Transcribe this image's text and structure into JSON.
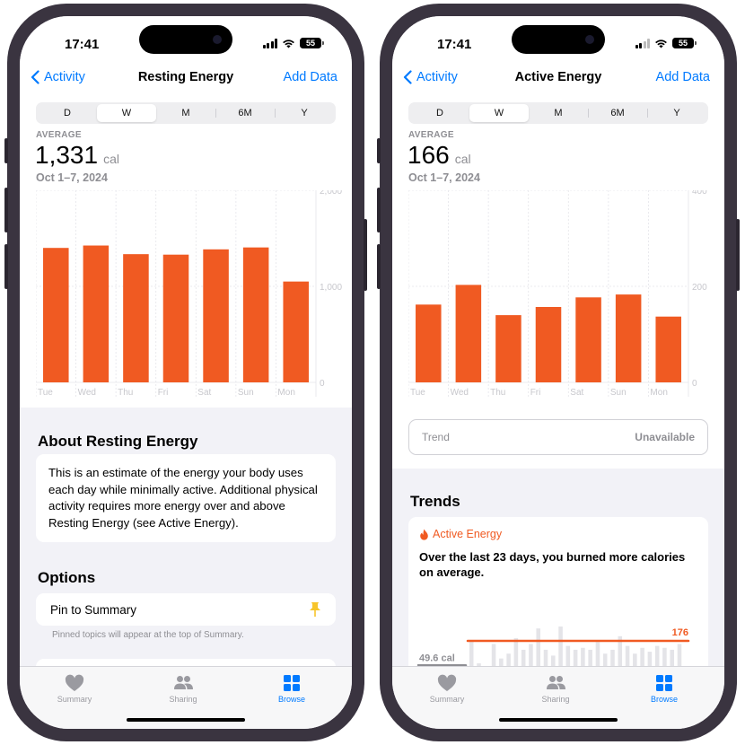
{
  "left": {
    "status": {
      "time": "17:41",
      "battery": "55"
    },
    "nav": {
      "back": "Activity",
      "title": "Resting Energy",
      "action": "Add Data"
    },
    "segments": [
      "D",
      "W",
      "M",
      "6M",
      "Y"
    ],
    "active_segment": "W",
    "average": {
      "label": "AVERAGE",
      "value": "1,331",
      "unit": "cal",
      "range": "Oct 1–7, 2024"
    },
    "chart_data": {
      "type": "bar",
      "categories": [
        "Tue",
        "Wed",
        "Thu",
        "Fri",
        "Sat",
        "Sun",
        "Mon"
      ],
      "values": [
        1400,
        1425,
        1335,
        1330,
        1385,
        1405,
        1050
      ],
      "ylim": [
        0,
        2000
      ],
      "yticks": [
        "2,000",
        "1,000",
        "0"
      ],
      "bar_color": "#f05a22"
    },
    "about": {
      "title": "About Resting Energy",
      "text": "This is an estimate of the energy your body uses each day while minimally active. Additional physical activity requires more energy over and above Resting Energy (see Active Energy)."
    },
    "options": {
      "title": "Options",
      "pin_label": "Pin to Summary",
      "pin_icon": "pin-icon",
      "footnote": "Pinned topics will appear at the top of Summary."
    }
  },
  "right": {
    "status": {
      "time": "17:41",
      "battery": "55"
    },
    "nav": {
      "back": "Activity",
      "title": "Active Energy",
      "action": "Add Data"
    },
    "segments": [
      "D",
      "W",
      "M",
      "6M",
      "Y"
    ],
    "active_segment": "W",
    "average": {
      "label": "AVERAGE",
      "value": "166",
      "unit": "cal",
      "range": "Oct 1–7, 2024"
    },
    "chart_data": {
      "type": "bar",
      "categories": [
        "Tue",
        "Wed",
        "Thu",
        "Fri",
        "Sat",
        "Sun",
        "Mon"
      ],
      "values": [
        162,
        203,
        140,
        157,
        177,
        183,
        137
      ],
      "ylim": [
        0,
        400
      ],
      "yticks": [
        "400",
        "200",
        "0"
      ],
      "bar_color": "#f05a22"
    },
    "trend": {
      "label": "Trend",
      "value": "Unavailable"
    },
    "trends": {
      "title": "Trends",
      "metric": "Active Energy",
      "description": "Over the last 23 days, you burned more calories on average.",
      "old_label": "49.6 cal",
      "new_label": "176",
      "chart_data": {
        "type": "bar",
        "values": [
          45,
          40,
          38,
          36,
          42,
          40,
          48,
          175,
          60,
          40,
          160,
          85,
          110,
          190,
          130,
          160,
          240,
          130,
          100,
          250,
          150,
          130,
          140,
          130,
          170,
          110,
          130,
          200,
          150,
          110,
          140,
          120,
          150,
          140,
          130,
          160
        ],
        "average_old": 49.6,
        "average_new": 176,
        "ylim": [
          0,
          250
        ],
        "line_color": "#f05a22",
        "bar_color": "#e4e4e8"
      }
    }
  },
  "tabs": [
    {
      "label": "Summary",
      "icon": "heart-icon"
    },
    {
      "label": "Sharing",
      "icon": "people-icon"
    },
    {
      "label": "Browse",
      "icon": "grid-icon"
    }
  ],
  "colors": {
    "accent": "#007aff",
    "energy": "#f05a22",
    "muted": "#8e8e93"
  }
}
